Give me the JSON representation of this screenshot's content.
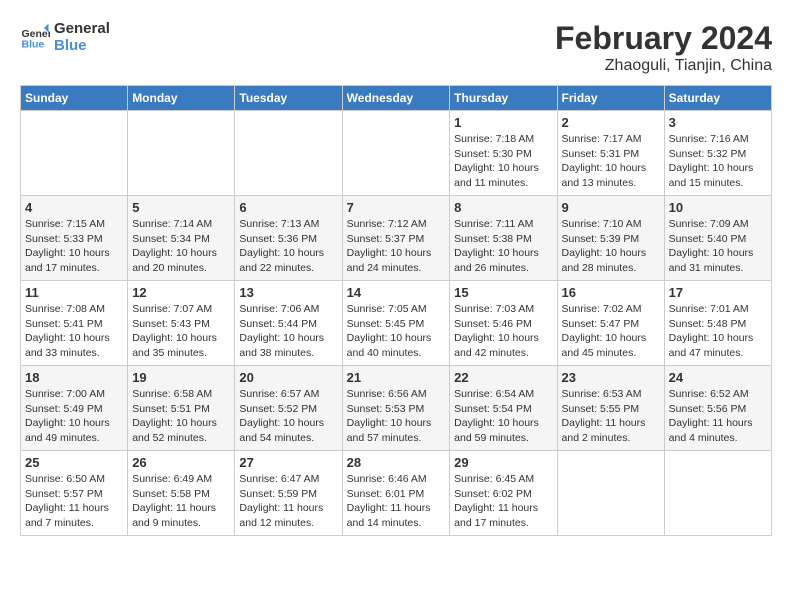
{
  "logo": {
    "text_general": "General",
    "text_blue": "Blue"
  },
  "title": "February 2024",
  "subtitle": "Zhaoguli, Tianjin, China",
  "weekdays": [
    "Sunday",
    "Monday",
    "Tuesday",
    "Wednesday",
    "Thursday",
    "Friday",
    "Saturday"
  ],
  "weeks": [
    [
      {
        "day": "",
        "info": ""
      },
      {
        "day": "",
        "info": ""
      },
      {
        "day": "",
        "info": ""
      },
      {
        "day": "",
        "info": ""
      },
      {
        "day": "1",
        "info": "Sunrise: 7:18 AM\nSunset: 5:30 PM\nDaylight: 10 hours\nand 11 minutes."
      },
      {
        "day": "2",
        "info": "Sunrise: 7:17 AM\nSunset: 5:31 PM\nDaylight: 10 hours\nand 13 minutes."
      },
      {
        "day": "3",
        "info": "Sunrise: 7:16 AM\nSunset: 5:32 PM\nDaylight: 10 hours\nand 15 minutes."
      }
    ],
    [
      {
        "day": "4",
        "info": "Sunrise: 7:15 AM\nSunset: 5:33 PM\nDaylight: 10 hours\nand 17 minutes."
      },
      {
        "day": "5",
        "info": "Sunrise: 7:14 AM\nSunset: 5:34 PM\nDaylight: 10 hours\nand 20 minutes."
      },
      {
        "day": "6",
        "info": "Sunrise: 7:13 AM\nSunset: 5:36 PM\nDaylight: 10 hours\nand 22 minutes."
      },
      {
        "day": "7",
        "info": "Sunrise: 7:12 AM\nSunset: 5:37 PM\nDaylight: 10 hours\nand 24 minutes."
      },
      {
        "day": "8",
        "info": "Sunrise: 7:11 AM\nSunset: 5:38 PM\nDaylight: 10 hours\nand 26 minutes."
      },
      {
        "day": "9",
        "info": "Sunrise: 7:10 AM\nSunset: 5:39 PM\nDaylight: 10 hours\nand 28 minutes."
      },
      {
        "day": "10",
        "info": "Sunrise: 7:09 AM\nSunset: 5:40 PM\nDaylight: 10 hours\nand 31 minutes."
      }
    ],
    [
      {
        "day": "11",
        "info": "Sunrise: 7:08 AM\nSunset: 5:41 PM\nDaylight: 10 hours\nand 33 minutes."
      },
      {
        "day": "12",
        "info": "Sunrise: 7:07 AM\nSunset: 5:43 PM\nDaylight: 10 hours\nand 35 minutes."
      },
      {
        "day": "13",
        "info": "Sunrise: 7:06 AM\nSunset: 5:44 PM\nDaylight: 10 hours\nand 38 minutes."
      },
      {
        "day": "14",
        "info": "Sunrise: 7:05 AM\nSunset: 5:45 PM\nDaylight: 10 hours\nand 40 minutes."
      },
      {
        "day": "15",
        "info": "Sunrise: 7:03 AM\nSunset: 5:46 PM\nDaylight: 10 hours\nand 42 minutes."
      },
      {
        "day": "16",
        "info": "Sunrise: 7:02 AM\nSunset: 5:47 PM\nDaylight: 10 hours\nand 45 minutes."
      },
      {
        "day": "17",
        "info": "Sunrise: 7:01 AM\nSunset: 5:48 PM\nDaylight: 10 hours\nand 47 minutes."
      }
    ],
    [
      {
        "day": "18",
        "info": "Sunrise: 7:00 AM\nSunset: 5:49 PM\nDaylight: 10 hours\nand 49 minutes."
      },
      {
        "day": "19",
        "info": "Sunrise: 6:58 AM\nSunset: 5:51 PM\nDaylight: 10 hours\nand 52 minutes."
      },
      {
        "day": "20",
        "info": "Sunrise: 6:57 AM\nSunset: 5:52 PM\nDaylight: 10 hours\nand 54 minutes."
      },
      {
        "day": "21",
        "info": "Sunrise: 6:56 AM\nSunset: 5:53 PM\nDaylight: 10 hours\nand 57 minutes."
      },
      {
        "day": "22",
        "info": "Sunrise: 6:54 AM\nSunset: 5:54 PM\nDaylight: 10 hours\nand 59 minutes."
      },
      {
        "day": "23",
        "info": "Sunrise: 6:53 AM\nSunset: 5:55 PM\nDaylight: 11 hours\nand 2 minutes."
      },
      {
        "day": "24",
        "info": "Sunrise: 6:52 AM\nSunset: 5:56 PM\nDaylight: 11 hours\nand 4 minutes."
      }
    ],
    [
      {
        "day": "25",
        "info": "Sunrise: 6:50 AM\nSunset: 5:57 PM\nDaylight: 11 hours\nand 7 minutes."
      },
      {
        "day": "26",
        "info": "Sunrise: 6:49 AM\nSunset: 5:58 PM\nDaylight: 11 hours\nand 9 minutes."
      },
      {
        "day": "27",
        "info": "Sunrise: 6:47 AM\nSunset: 5:59 PM\nDaylight: 11 hours\nand 12 minutes."
      },
      {
        "day": "28",
        "info": "Sunrise: 6:46 AM\nSunset: 6:01 PM\nDaylight: 11 hours\nand 14 minutes."
      },
      {
        "day": "29",
        "info": "Sunrise: 6:45 AM\nSunset: 6:02 PM\nDaylight: 11 hours\nand 17 minutes."
      },
      {
        "day": "",
        "info": ""
      },
      {
        "day": "",
        "info": ""
      }
    ]
  ]
}
